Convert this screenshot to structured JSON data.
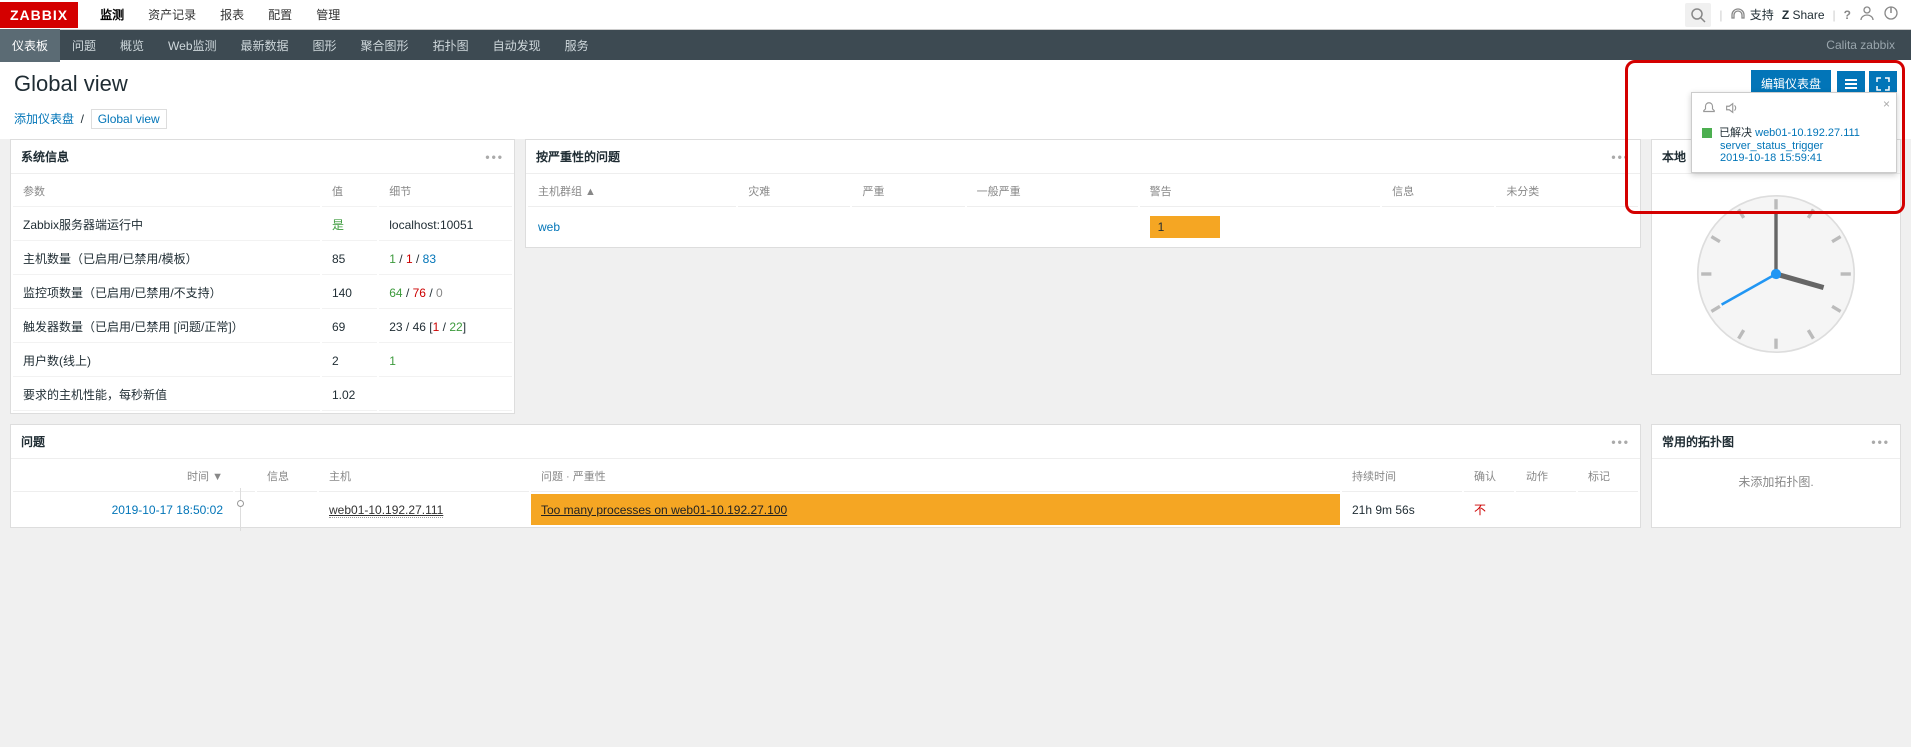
{
  "brand": "ZABBIX",
  "topnav": [
    "监测",
    "资产记录",
    "报表",
    "配置",
    "管理"
  ],
  "topnav_active": 0,
  "topright": {
    "support": "支持",
    "share": "Share"
  },
  "subnav": [
    "仪表板",
    "问题",
    "概览",
    "Web监测",
    "最新数据",
    "图形",
    "聚合图形",
    "拓扑图",
    "自动发现",
    "服务"
  ],
  "subnav_active": 0,
  "user_label": "Calita zabbix",
  "page_title": "Global view",
  "edit_btn": "编辑仪表盘",
  "breadcrumb": {
    "add": "添加仪表盘",
    "current": "Global view"
  },
  "sysinfo": {
    "title": "系统信息",
    "headers": {
      "param": "参数",
      "value": "值",
      "detail": "细节"
    },
    "rows": [
      {
        "p": "Zabbix服务器端运行中",
        "v": "是",
        "v_class": "green",
        "d": "localhost:10051"
      },
      {
        "p": "主机数量（已启用/已禁用/模板）",
        "v": "85",
        "d_parts": [
          {
            "t": "1",
            "c": "green"
          },
          {
            "t": " / "
          },
          {
            "t": "1",
            "c": "red"
          },
          {
            "t": " / "
          },
          {
            "t": "83",
            "c": "blue"
          }
        ]
      },
      {
        "p": "监控项数量（已启用/已禁用/不支持）",
        "v": "140",
        "d_parts": [
          {
            "t": "64",
            "c": "green"
          },
          {
            "t": " / "
          },
          {
            "t": "76",
            "c": "red"
          },
          {
            "t": " / "
          },
          {
            "t": "0",
            "c": "gray"
          }
        ]
      },
      {
        "p": "触发器数量（已启用/已禁用 [问题/正常]）",
        "v": "69",
        "d_parts": [
          {
            "t": "23 / 46 ["
          },
          {
            "t": "1",
            "c": "red"
          },
          {
            "t": " / "
          },
          {
            "t": "22",
            "c": "green"
          },
          {
            "t": "]"
          }
        ]
      },
      {
        "p": "用户数(线上)",
        "v": "2",
        "d_parts": [
          {
            "t": "1",
            "c": "green"
          }
        ]
      },
      {
        "p": "要求的主机性能，每秒新值",
        "v": "1.02",
        "d": ""
      }
    ]
  },
  "severity": {
    "title": "按严重性的问题",
    "headers": [
      "主机群组 ▲",
      "灾难",
      "严重",
      "一般严重",
      "警告",
      "信息",
      "未分类"
    ],
    "row": {
      "group": "web",
      "warn": "1"
    }
  },
  "clock": {
    "title": "本地"
  },
  "problems": {
    "title": "问题",
    "headers": {
      "time": "时间 ▼",
      "info": "信息",
      "host": "主机",
      "problem": "问题 · 严重性",
      "duration": "持续时间",
      "ack": "确认",
      "actions": "动作",
      "tags": "标记"
    },
    "row": {
      "time": "2019-10-17 18:50:02",
      "host": "web01-10.192.27.111",
      "problem": "Too many processes on web01-10.192.27.100",
      "duration": "21h 9m 56s",
      "ack": "不"
    }
  },
  "maps": {
    "title": "常用的拓扑图",
    "empty": "未添加拓扑图."
  },
  "notif": {
    "status": "已解决",
    "host": "web01-10.192.27.111",
    "trigger": "server_status_trigger",
    "time": "2019-10-18 15:59:41"
  }
}
